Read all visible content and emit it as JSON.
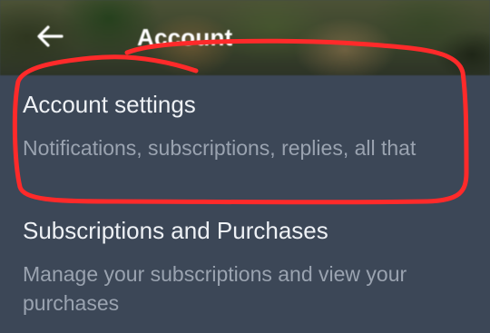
{
  "header": {
    "title": "Account",
    "back_icon": "arrow-left-icon"
  },
  "items": [
    {
      "title": "Account settings",
      "description": "Notifications, subscriptions, replies, all that"
    },
    {
      "title": "Subscriptions and Purchases",
      "description": "Manage your subscriptions and view your purchases"
    }
  ],
  "colors": {
    "background": "#3c4757",
    "title_text": "#eef1f5",
    "description_text": "#9aa3b0",
    "annotation_stroke": "#ff2a2a"
  }
}
